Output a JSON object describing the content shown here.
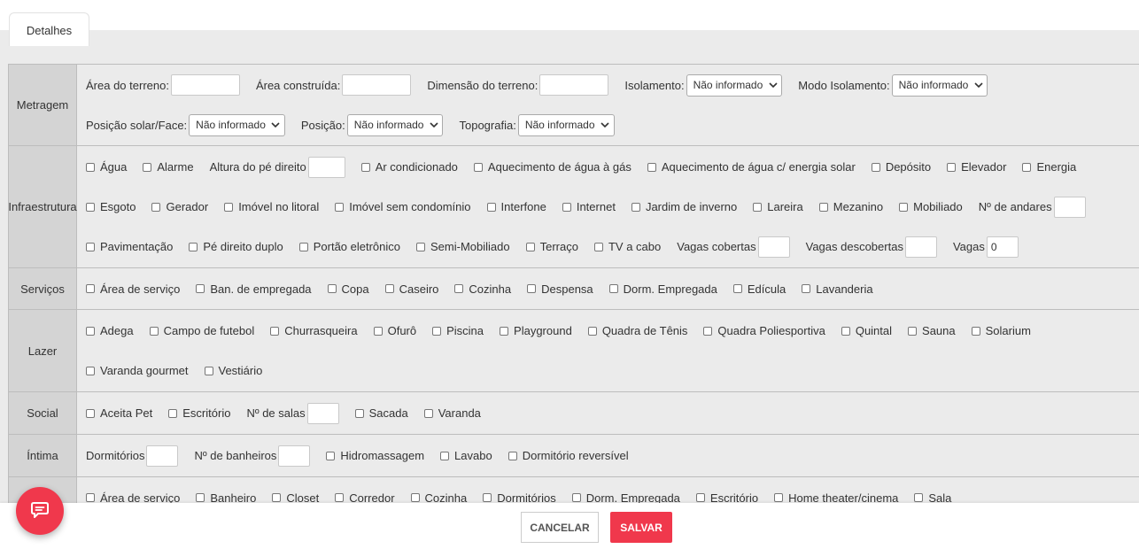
{
  "tab": {
    "label": "Detalhes"
  },
  "select_default": "Não informado",
  "metragem": {
    "label": "Metragem",
    "area_terreno": "Área do terreno:",
    "area_construida": "Área construída:",
    "dimensao": "Dimensão do terreno:",
    "isolamento": "Isolamento:",
    "modo_isolamento": "Modo Isolamento:",
    "posicao_solar": "Posição solar/Face:",
    "posicao": "Posição:",
    "topografia": "Topografia:"
  },
  "infra": {
    "label": "Infraestrutura",
    "items": [
      "Água",
      "Alarme",
      "Ar condicionado",
      "Aquecimento de água à gás",
      "Aquecimento de água c/ energia solar",
      "Depósito",
      "Elevador",
      "Energia",
      "Esgoto",
      "Gerador",
      "Imóvel no litoral",
      "Imóvel sem condomínio",
      "Interfone",
      "Internet",
      "Jardim de inverno",
      "Lareira",
      "Mezanino",
      "Mobiliado",
      "Pavimentação",
      "Pé direito duplo",
      "Portão eletrônico",
      "Semi-Mobiliado",
      "Terraço",
      "TV a cabo"
    ],
    "altura_pe_direito": "Altura do pé direito",
    "n_andares": "Nº de andares",
    "vagas_cobertas": "Vagas cobertas",
    "vagas_descobertas": "Vagas descobertas",
    "vagas": "Vagas",
    "vagas_value": "0"
  },
  "servicos": {
    "label": "Serviços",
    "items": [
      "Área de serviço",
      "Ban. de empregada",
      "Copa",
      "Caseiro",
      "Cozinha",
      "Despensa",
      "Dorm. Empregada",
      "Edícula",
      "Lavanderia"
    ]
  },
  "lazer": {
    "label": "Lazer",
    "items": [
      "Adega",
      "Campo de futebol",
      "Churrasqueira",
      "Ofurô",
      "Piscina",
      "Playground",
      "Quadra de Tênis",
      "Quadra Poliesportiva",
      "Quintal",
      "Sauna",
      "Solarium",
      "Varanda gourmet",
      "Vestiário"
    ]
  },
  "social": {
    "label": "Social",
    "items": [
      "Aceita Pet",
      "Escritório",
      "Sacada",
      "Varanda"
    ],
    "n_salas": "Nº de salas"
  },
  "intima": {
    "label": "Íntima",
    "dormitorios": "Dormitórios",
    "n_banheiros": "Nº de banheiros",
    "items": [
      "Hidromassagem",
      "Lavabo",
      "Dormitório reversível"
    ]
  },
  "armarios": {
    "items": [
      "Área de serviço",
      "Banheiro",
      "Closet",
      "Corredor",
      "Cozinha",
      "Dormitórios",
      "Dorm. Empregada",
      "Escritório",
      "Home theater/cinema",
      "Sala"
    ]
  },
  "footer": {
    "cancel": "CANCELAR",
    "save": "SALVAR"
  },
  "colors": {
    "accent": "#f0384c",
    "label_bg": "#d4d4d4",
    "content_bg": "#ebebeb"
  },
  "icons": {
    "chat": "chat-bubble-icon",
    "select": "chevron-down-icon"
  }
}
